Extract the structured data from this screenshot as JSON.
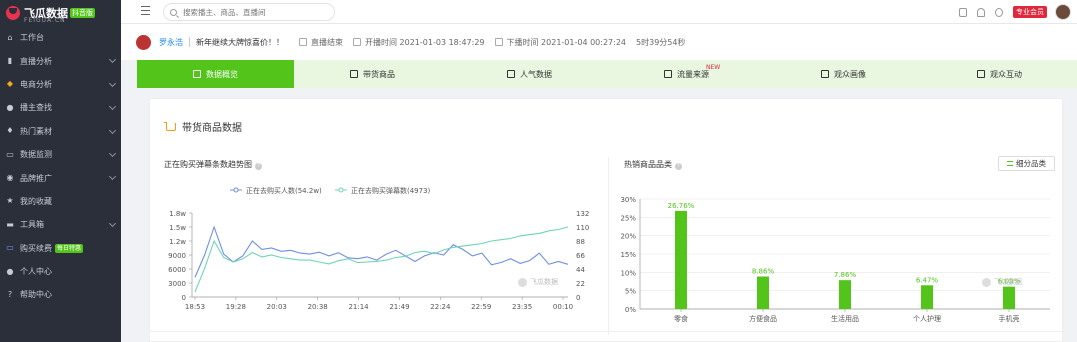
{
  "brand": {
    "name": "飞瓜数据",
    "sub": "FEIGUA.CN",
    "badge": "抖音版"
  },
  "sidebar": {
    "items": [
      {
        "label": "工作台",
        "icon": "home-icon",
        "arrow": false
      },
      {
        "label": "直播分析",
        "icon": "live-bars-icon",
        "arrow": true
      },
      {
        "label": "电商分析",
        "icon": "bag-icon",
        "arrow": true
      },
      {
        "label": "播主查找",
        "icon": "search-user-icon",
        "arrow": true
      },
      {
        "label": "热门素材",
        "icon": "fire-icon",
        "arrow": true
      },
      {
        "label": "数据监测",
        "icon": "monitor-icon",
        "arrow": true
      },
      {
        "label": "品牌推广",
        "icon": "tag-icon",
        "arrow": true
      },
      {
        "label": "我的收藏",
        "icon": "star-icon",
        "arrow": false
      },
      {
        "label": "工具箱",
        "icon": "toolbox-icon",
        "arrow": true
      },
      {
        "label": "购买续费",
        "icon": "card-icon",
        "arrow": false,
        "badge": "每日特惠"
      },
      {
        "label": "个人中心",
        "icon": "user-icon",
        "arrow": false
      },
      {
        "label": "帮助中心",
        "icon": "help-icon",
        "arrow": false
      }
    ]
  },
  "topbar": {
    "search_placeholder": "搜索播主、商品、直播间",
    "vip_label": "专业会员"
  },
  "info": {
    "anchor_name": "罗永浩",
    "room_title": "新年继续大牌惊喜价！！",
    "status": "直播结束",
    "start": "开播时间 2021-01-03 18:47:29",
    "end": "下播时间 2021-01-04 00:27:24",
    "duration": "5时39分54秒"
  },
  "tabs": [
    {
      "label": "数据概览",
      "icon": "chart-bars-icon",
      "active": true
    },
    {
      "label": "带货商品",
      "icon": "bag-icon",
      "active": false
    },
    {
      "label": "人气数据",
      "icon": "fire-icon",
      "active": false
    },
    {
      "label": "流量来源",
      "icon": "source-icon",
      "active": false,
      "badge": "NEW"
    },
    {
      "label": "观众画像",
      "icon": "portrait-icon",
      "active": false
    },
    {
      "label": "观众互动",
      "icon": "interact-icon",
      "active": false
    }
  ],
  "section_title": "带货商品数据",
  "category_button": "细分品类",
  "watermark": "飞瓜数据",
  "colors": {
    "green": "#52c41a",
    "line_blue": "#6f8fe0",
    "line_teal": "#6fd4b5",
    "vip_red": "#e0273b"
  },
  "chart_data": [
    {
      "type": "line",
      "title": "正在购买弹幕条数趋势图",
      "x_ticks": [
        "18:53",
        "19:28",
        "20:03",
        "20:38",
        "21:14",
        "21:49",
        "22:24",
        "22:59",
        "23:35",
        "00:10"
      ],
      "y_left_ticks": [
        "0",
        "3000",
        "6000",
        "9000",
        "1.2w",
        "1.5w",
        "1.8w"
      ],
      "y_right_ticks": [
        "0",
        "22",
        "44",
        "66",
        "88",
        "110",
        "132"
      ],
      "ylim_left": [
        0,
        18000
      ],
      "ylim_right": [
        0,
        132
      ],
      "series": [
        {
          "name": "正在去购买人数(54.2w)",
          "axis": "left",
          "values": [
            4200,
            9000,
            15000,
            9200,
            7500,
            8800,
            12000,
            10200,
            10500,
            9800,
            10000,
            9400,
            9200,
            9600,
            8800,
            9500,
            8400,
            8200,
            8600,
            7900,
            9200,
            10000,
            8800,
            7600,
            8800,
            9500,
            9000,
            11200,
            10200,
            8800,
            9400,
            6900,
            7400,
            8200,
            7200,
            7800,
            9400,
            7000,
            7600,
            7000
          ]
        },
        {
          "name": "正在去购买弹幕数(4973)",
          "axis": "right",
          "values": [
            8,
            45,
            88,
            62,
            55,
            60,
            70,
            63,
            66,
            62,
            60,
            58,
            58,
            55,
            52,
            57,
            60,
            54,
            55,
            56,
            58,
            62,
            64,
            70,
            72,
            68,
            74,
            78,
            80,
            82,
            84,
            88,
            90,
            92,
            96,
            98,
            100,
            104,
            106,
            110
          ]
        }
      ]
    },
    {
      "type": "bar",
      "title": "热销商品品类",
      "categories": [
        "零食",
        "方便食品",
        "生活用品",
        "个人护理",
        "手机壳"
      ],
      "values": [
        26.76,
        8.86,
        7.86,
        6.47,
        6.09
      ],
      "value_labels": [
        "26.76%",
        "8.86%",
        "7.86%",
        "6.47%",
        "6.09%"
      ],
      "y_ticks": [
        "0%",
        "5%",
        "10%",
        "15%",
        "20%",
        "25%",
        "30%"
      ],
      "ylim": [
        0,
        30
      ]
    }
  ]
}
